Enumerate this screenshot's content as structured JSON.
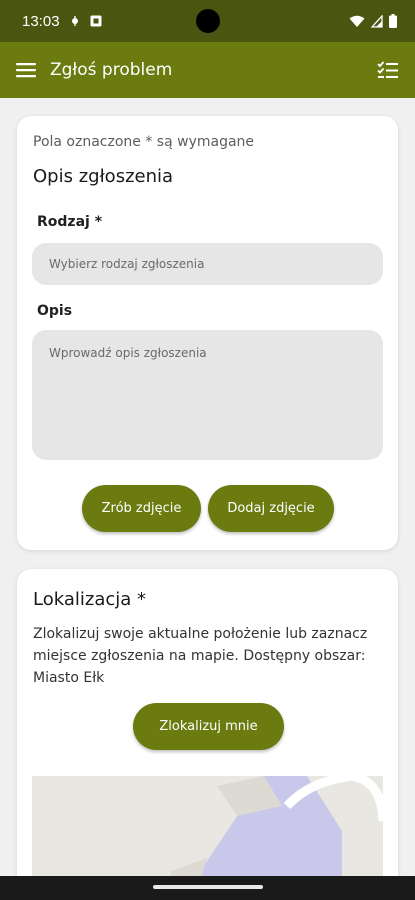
{
  "status_bar": {
    "time": "13:03"
  },
  "app_bar": {
    "title": "Zgłoś problem",
    "menu_icon": "hamburger-menu-icon",
    "right_icon": "checklist-icon"
  },
  "form": {
    "required_note": "Pola oznaczone * są wymagane",
    "section_title": "Opis zgłoszenia",
    "type_label": "Rodzaj *",
    "type_placeholder": "Wybierz rodzaj zgłoszenia",
    "description_label": "Opis",
    "description_placeholder": "Wprowadź opis zgłoszenia",
    "take_photo_label": "Zrób zdjęcie",
    "add_photo_label": "Dodaj zdjęcie"
  },
  "location": {
    "title": "Lokalizacja *",
    "description": "Zlokalizuj swoje aktualne położenie lub zaznacz miejsce zgłoszenia na mapie. Dostępny obszar: Miasto Ełk",
    "locate_label": "Zlokalizuj mnie"
  },
  "colors": {
    "status_bar": "#4a5610",
    "app_bar": "#6b7b10",
    "button": "#6b7b10",
    "input_bg": "#e6e6e6",
    "page_bg": "#f0f0f0"
  }
}
